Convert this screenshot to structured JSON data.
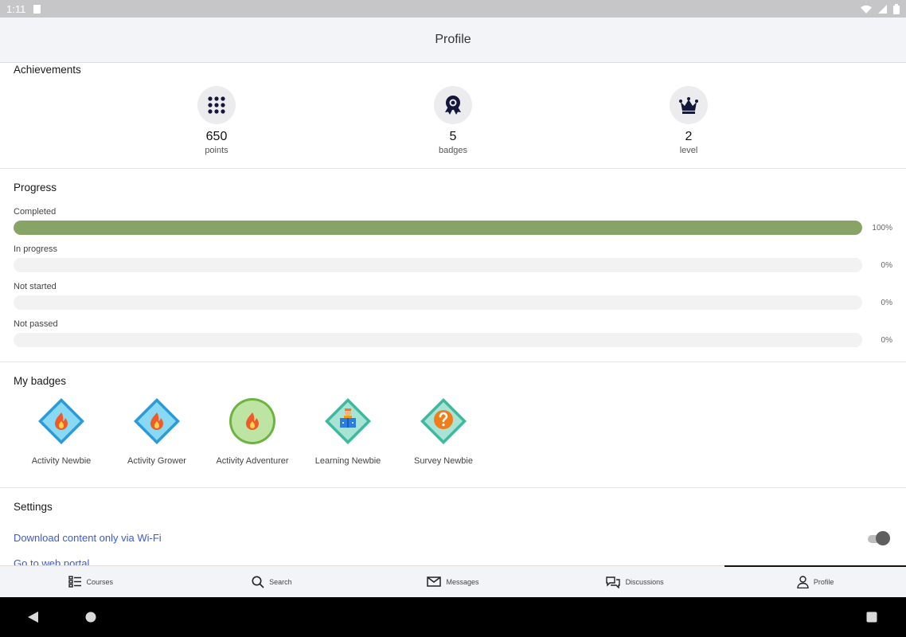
{
  "status": {
    "time": "1:11"
  },
  "header": {
    "title": "Profile"
  },
  "achievements": {
    "title": "Achievements",
    "stats": [
      {
        "value": "650",
        "label": "points",
        "icon": "grid-dots-icon"
      },
      {
        "value": "5",
        "label": "badges",
        "icon": "ribbon-badge-icon"
      },
      {
        "value": "2",
        "label": "level",
        "icon": "crown-icon"
      }
    ]
  },
  "progress": {
    "title": "Progress",
    "rows": [
      {
        "label": "Completed",
        "percent": "100%",
        "value": 100
      },
      {
        "label": "In progress",
        "percent": "0%",
        "value": 0
      },
      {
        "label": "Not started",
        "percent": "0%",
        "value": 0
      },
      {
        "label": "Not passed",
        "percent": "0%",
        "value": 0
      }
    ],
    "fill_color": "#87a365"
  },
  "badges": {
    "title": "My badges",
    "items": [
      {
        "label": "Activity Newbie",
        "icon": "flame-diamond-icon"
      },
      {
        "label": "Activity Grower",
        "icon": "flame-diamond-icon"
      },
      {
        "label": "Activity Adventurer",
        "icon": "flame-circle-icon"
      },
      {
        "label": "Learning Newbie",
        "icon": "reader-diamond-icon"
      },
      {
        "label": "Survey Newbie",
        "icon": "question-diamond-icon"
      }
    ]
  },
  "settings": {
    "title": "Settings",
    "wifi_label": "Download content only via Wi-Fi",
    "wifi_enabled": true,
    "portal_label": "Go to web portal"
  },
  "tabs": [
    {
      "label": "Courses",
      "icon": "courses-list-icon"
    },
    {
      "label": "Search",
      "icon": "search-icon"
    },
    {
      "label": "Messages",
      "icon": "envelope-icon"
    },
    {
      "label": "Discussions",
      "icon": "chat-bubbles-icon"
    },
    {
      "label": "Profile",
      "icon": "user-icon",
      "active": true
    }
  ]
}
